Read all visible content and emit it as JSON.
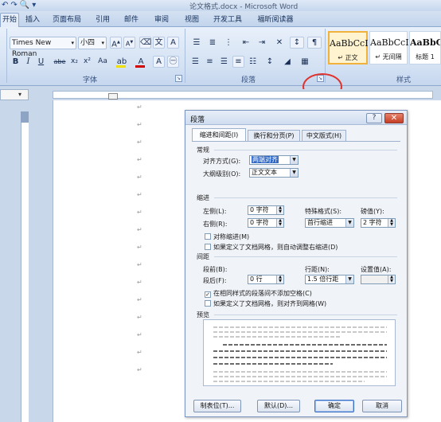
{
  "window": {
    "title": "论文格式.docx - Microsoft Word",
    "quick_access": [
      "↶",
      "↷",
      "🔍",
      "▾"
    ]
  },
  "ribbon": {
    "tabs": [
      "开始",
      "插入",
      "页面布局",
      "引用",
      "邮件",
      "审阅",
      "视图",
      "开发工具",
      "福昕阅读器"
    ],
    "font": {
      "name": "Times New Roman",
      "size": "小四",
      "group_label": "字体",
      "buttons": [
        "B",
        "I",
        "U",
        "abe",
        "x₂",
        "x²",
        "Aa",
        "A",
        "A"
      ]
    },
    "paragraph": {
      "group_label": "段落"
    },
    "styles": {
      "group_label": "样式",
      "items": [
        {
          "sample": "AaBbCcI",
          "name": "↵ 正文"
        },
        {
          "sample": "AaBbCcI",
          "name": "↵ 无间隔"
        },
        {
          "sample": "AaBbC",
          "name": "标题 1"
        }
      ]
    },
    "colors": {
      "highlight": "#f0e000",
      "font_color": "#d00000",
      "annotation": "#e0332e"
    }
  },
  "document": {
    "paragraph_mark": "↵",
    "paragraph_count": 16
  },
  "dialog": {
    "title": "段落",
    "help": "?",
    "close": "✕",
    "tabs": [
      "缩进和间距(I)",
      "换行和分页(P)",
      "中文版式(H)"
    ],
    "general": {
      "section": "常规",
      "alignment_label": "对齐方式(G):",
      "alignment_value": "两端对齐",
      "outline_label": "大纲级别(O):",
      "outline_value": "正文文本"
    },
    "indent": {
      "section": "缩进",
      "left_label": "左侧(L):",
      "left_value": "0 字符",
      "right_label": "右侧(R):",
      "right_value": "0 字符",
      "special_label": "特殊格式(S):",
      "special_value": "首行缩进",
      "by_label": "磅值(Y):",
      "by_value": "2 字符",
      "mirror": "对称缩进(M)",
      "grid": "如果定义了文档网格，则自动调整右缩进(D)"
    },
    "spacing": {
      "section": "间距",
      "before_label": "段前(B):",
      "before_value": "0 行",
      "after_label": "段后(F):",
      "after_value": "0 行",
      "line_label": "行距(N):",
      "line_value": "1.5 倍行距",
      "at_label": "设置值(A):",
      "at_value": "",
      "no_space": "在相同样式的段落间不添加空格(C)",
      "snap": "如果定义了文档网格，则对齐到网格(W)"
    },
    "preview": {
      "section": "预览"
    },
    "buttons": {
      "tabs": "制表位(T)...",
      "default": "默认(D)...",
      "ok": "确定",
      "cancel": "取消"
    }
  }
}
